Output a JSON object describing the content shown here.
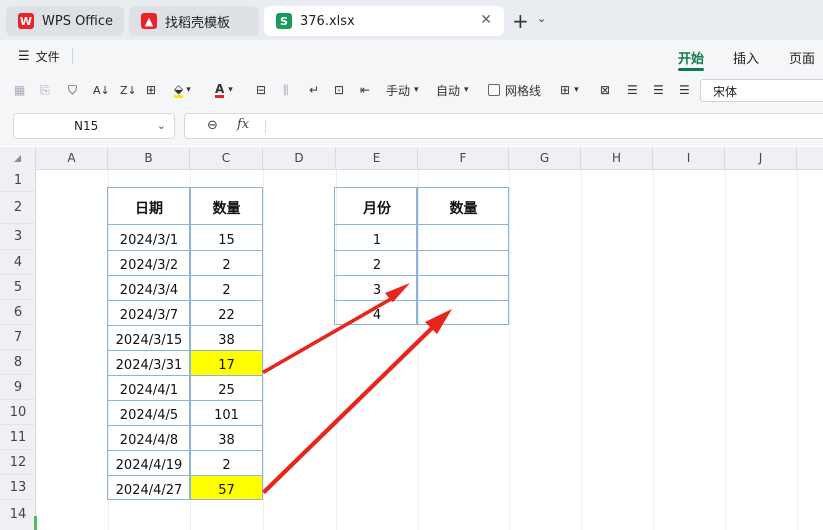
{
  "tabs": [
    {
      "label": "WPS Office",
      "icon": "wps-logo-icon",
      "color": "#e8232a"
    },
    {
      "label": "找稻壳模板",
      "icon": "docer-logo-icon",
      "color": "#e8232a"
    },
    {
      "label": "376.xlsx",
      "icon": "spreadsheet-s-icon",
      "color": "#1a9b5c",
      "active": true
    }
  ],
  "menu": {
    "file_label": "文件",
    "ribbon_tabs": [
      "开始",
      "插入",
      "页面"
    ],
    "active_tab": "开始"
  },
  "toolbar": {
    "wrap_manual": "手动",
    "wrap_auto": "自动",
    "gridlines_label": "网格线",
    "gridlines_checked": false,
    "font_name": "宋体",
    "accent_color": "#0f7b4a"
  },
  "formula_bar": {
    "cell_ref": "N15",
    "fx_label": "fx",
    "formula": ""
  },
  "sheet": {
    "columns": [
      "A",
      "B",
      "C",
      "D",
      "E",
      "F",
      "G",
      "H",
      "I",
      "J"
    ],
    "rows": [
      "1",
      "2",
      "3",
      "4",
      "5",
      "6",
      "7",
      "8",
      "9",
      "10",
      "11",
      "12",
      "13",
      "14"
    ],
    "table1": {
      "headers": [
        "日期",
        "数量"
      ],
      "rows": [
        {
          "date": "2024/3/1",
          "qty": "15",
          "highlight": false
        },
        {
          "date": "2024/3/2",
          "qty": "2",
          "highlight": false
        },
        {
          "date": "2024/3/4",
          "qty": "2",
          "highlight": false
        },
        {
          "date": "2024/3/7",
          "qty": "22",
          "highlight": false
        },
        {
          "date": "2024/3/15",
          "qty": "38",
          "highlight": false
        },
        {
          "date": "2024/3/31",
          "qty": "17",
          "highlight": true
        },
        {
          "date": "2024/4/1",
          "qty": "25",
          "highlight": false
        },
        {
          "date": "2024/4/5",
          "qty": "101",
          "highlight": false
        },
        {
          "date": "2024/4/8",
          "qty": "38",
          "highlight": false
        },
        {
          "date": "2024/4/19",
          "qty": "2",
          "highlight": false
        },
        {
          "date": "2024/4/27",
          "qty": "57",
          "highlight": true
        }
      ]
    },
    "table2": {
      "headers": [
        "月份",
        "数量"
      ],
      "rows": [
        {
          "month": "1",
          "qty": ""
        },
        {
          "month": "2",
          "qty": ""
        },
        {
          "month": "3",
          "qty": ""
        },
        {
          "month": "4",
          "qty": ""
        }
      ]
    },
    "highlight_color": "#ffff00",
    "arrow_color": "#e8251b"
  }
}
